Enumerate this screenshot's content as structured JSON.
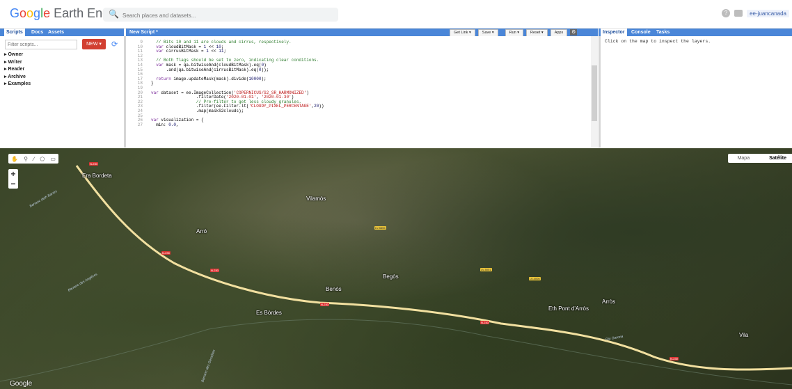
{
  "app": {
    "logo_google": "Google",
    "logo_rest": " Earth Engine",
    "search_placeholder": "Search places and datasets...",
    "user": "ee-juancanada"
  },
  "left_panel": {
    "tabs": [
      "Scripts",
      "Docs",
      "Assets"
    ],
    "filter_placeholder": "Filter scripts...",
    "new_label": "NEW",
    "tree": [
      "Owner",
      "Writer",
      "Reader",
      "Archive",
      "Examples"
    ]
  },
  "editor": {
    "title": "New Script *",
    "buttons": [
      "Get Link",
      "Save",
      "Run",
      "Reset",
      "Apps"
    ],
    "line_numbers": [
      "9",
      "10",
      "11",
      "12",
      "13",
      "14",
      "15",
      "16",
      "17",
      "18",
      "19",
      "20",
      "21",
      "22",
      "23",
      "24",
      "25",
      "26",
      "27"
    ]
  },
  "right_panel": {
    "tabs": [
      "Inspector",
      "Console",
      "Tasks"
    ],
    "message": "Click on the map to inspect the layers."
  },
  "map": {
    "map_types": [
      "Mapa",
      "Satélite"
    ],
    "attribution": "Google",
    "places": [
      "Era Bordeta",
      "Vilamòs",
      "Arró",
      "Begòs",
      "Benòs",
      "Es Bòrdes",
      "Eth Pont d'Arròs",
      "Arròs",
      "Vila"
    ],
    "roads": [
      "N-230",
      "LV-5855",
      "LV-5051",
      "LV-4006"
    ],
    "rivers": [
      "Barranc deth Barrés",
      "Barranc des Anglères",
      "Riu Garona",
      "Barranc des Gessèles"
    ]
  }
}
